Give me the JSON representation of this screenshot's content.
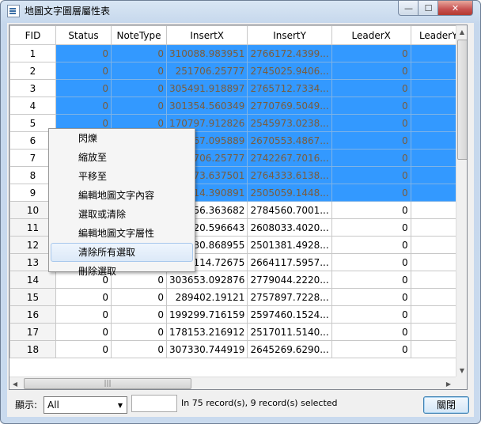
{
  "window": {
    "title": "地圖文字圖層屬性表",
    "min_label": "—",
    "max_label": "☐",
    "close_label": "✕"
  },
  "table": {
    "columns": [
      "FID",
      "Status",
      "NoteType",
      "InsertX",
      "InsertY",
      "LeaderX",
      "LeaderY"
    ],
    "rows": [
      {
        "fid": "1",
        "status": "0",
        "notetype": "0",
        "x": "310088.983951",
        "y": "2766172.4399...",
        "leaderx": "0",
        "selected": true
      },
      {
        "fid": "2",
        "status": "0",
        "notetype": "0",
        "x": "251706.25777",
        "y": "2745025.9406...",
        "leaderx": "0",
        "selected": true
      },
      {
        "fid": "3",
        "status": "0",
        "notetype": "0",
        "x": "305491.918897",
        "y": "2765712.7334...",
        "leaderx": "0",
        "selected": true
      },
      {
        "fid": "4",
        "status": "0",
        "notetype": "0",
        "x": "301354.560349",
        "y": "2770769.5049...",
        "leaderx": "0",
        "selected": true
      },
      {
        "fid": "5",
        "status": "0",
        "notetype": "0",
        "x": "170797.912826",
        "y": "2545973.0238...",
        "leaderx": "0",
        "selected": true
      },
      {
        "fid": "6",
        "status": "0",
        "notetype": "0",
        "x": "67.095889",
        "y": "2670553.4867...",
        "leaderx": "0",
        "selected": true
      },
      {
        "fid": "7",
        "status": "0",
        "notetype": "0",
        "x": "706.25777",
        "y": "2742267.7016...",
        "leaderx": "0",
        "selected": true
      },
      {
        "fid": "8",
        "status": "0",
        "notetype": "0",
        "x": "73.637501",
        "y": "2764333.6138...",
        "leaderx": "0",
        "selected": true
      },
      {
        "fid": "9",
        "status": "0",
        "notetype": "0",
        "x": "14.390891",
        "y": "2505059.1448...",
        "leaderx": "0",
        "selected": true
      },
      {
        "fid": "10",
        "status": "0",
        "notetype": "0",
        "x": "56.363682",
        "y": "2784560.7001...",
        "leaderx": "0",
        "selected": false
      },
      {
        "fid": "11",
        "status": "0",
        "notetype": "0",
        "x": "20.596643",
        "y": "2608033.4020...",
        "leaderx": "0",
        "selected": false
      },
      {
        "fid": "12",
        "status": "0",
        "notetype": "0",
        "x": "30.868955",
        "y": "2501381.4928...",
        "leaderx": "0",
        "selected": false
      },
      {
        "fid": "13",
        "status": "0",
        "notetype": "0",
        "x": "114.72675",
        "y": "2664117.5957...",
        "leaderx": "0",
        "selected": false
      },
      {
        "fid": "14",
        "status": "0",
        "notetype": "0",
        "x": "303653.092876",
        "y": "2779044.2220...",
        "leaderx": "0",
        "selected": false
      },
      {
        "fid": "15",
        "status": "0",
        "notetype": "0",
        "x": "289402.19121",
        "y": "2757897.7228...",
        "leaderx": "0",
        "selected": false
      },
      {
        "fid": "16",
        "status": "0",
        "notetype": "0",
        "x": "199299.716159",
        "y": "2597460.1524...",
        "leaderx": "0",
        "selected": false
      },
      {
        "fid": "17",
        "status": "0",
        "notetype": "0",
        "x": "178153.216912",
        "y": "2517011.5140...",
        "leaderx": "0",
        "selected": false
      },
      {
        "fid": "18",
        "status": "0",
        "notetype": "0",
        "x": "307330.744919",
        "y": "2645269.6290...",
        "leaderx": "0",
        "selected": false
      }
    ]
  },
  "context_menu": {
    "items": [
      "閃爍",
      "縮放至",
      "平移至",
      "編輯地圖文字內容",
      "選取或清除",
      "編輯地圖文字層性",
      "清除所有選取",
      "刪除選取"
    ],
    "highlighted_index": 6
  },
  "footer": {
    "show_label": "顯示:",
    "filter_value": "All",
    "status_text": "In 75 record(s), 9 record(s) selected",
    "close_button": "關閉"
  },
  "colors": {
    "selection": "#3399ff",
    "selected_text": "#7a5c3e"
  }
}
